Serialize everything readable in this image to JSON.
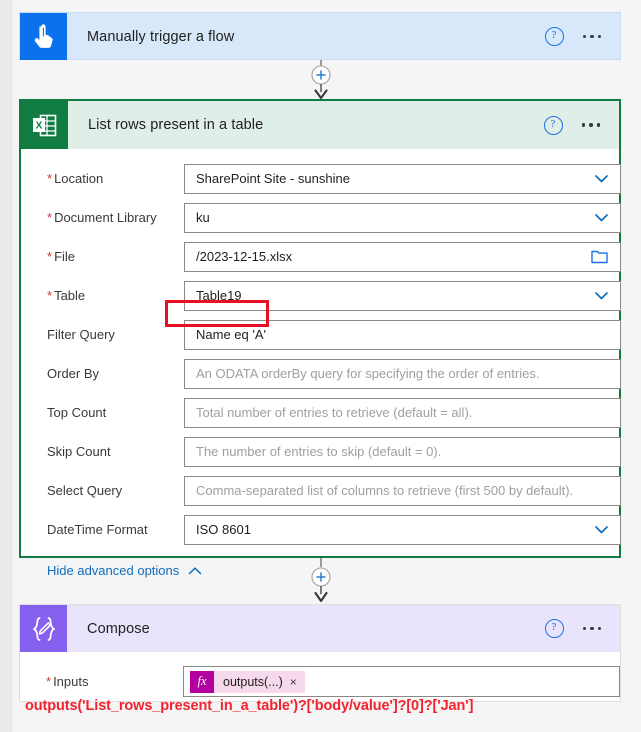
{
  "trigger_card": {
    "title": "Manually trigger a flow",
    "icon": "hand-tap-icon",
    "icon_bg": "#0b71ec",
    "card_bg": "#d7e8fb",
    "help_label": "?",
    "menu_label": "..."
  },
  "excel_card": {
    "title": "List rows present in a table",
    "icon": "excel-icon",
    "icon_bg": "#107c41",
    "header_bg": "#dfeee6",
    "border_color": "#107c41",
    "help_label": "?",
    "menu_label": "...",
    "fields": [
      {
        "label": "Location",
        "required": true,
        "value": "SharePoint Site - sunshine",
        "placeholder": "",
        "control": "dropdown"
      },
      {
        "label": "Document Library",
        "required": true,
        "value": "ku",
        "placeholder": "",
        "control": "dropdown"
      },
      {
        "label": "File",
        "required": true,
        "value": "/2023-12-15.xlsx",
        "placeholder": "",
        "control": "filepicker"
      },
      {
        "label": "Table",
        "required": true,
        "value": "Table19",
        "placeholder": "",
        "control": "dropdown"
      },
      {
        "label": "Filter Query",
        "required": false,
        "value": "Name eq 'A'",
        "placeholder": "",
        "control": "text"
      },
      {
        "label": "Order By",
        "required": false,
        "value": "",
        "placeholder": "An ODATA orderBy query for specifying the order of entries.",
        "control": "text"
      },
      {
        "label": "Top Count",
        "required": false,
        "value": "",
        "placeholder": "Total number of entries to retrieve (default = all).",
        "control": "text"
      },
      {
        "label": "Skip Count",
        "required": false,
        "value": "",
        "placeholder": "The number of entries to skip (default = 0).",
        "control": "text"
      },
      {
        "label": "Select Query",
        "required": false,
        "value": "",
        "placeholder": "Comma-separated list of columns to retrieve (first 500 by default).",
        "control": "text"
      },
      {
        "label": "DateTime Format",
        "required": true,
        "value": "ISO 8601",
        "placeholder": "",
        "control": "dropdown"
      }
    ],
    "advanced_toggle": "Hide advanced options",
    "advanced_chevron": "chevron-up-icon"
  },
  "compose_card": {
    "title": "Compose",
    "icon": "compose-braces-pencil-icon",
    "icon_bg": "#8661ef",
    "header_bg": "#e9e3fb",
    "help_label": "?",
    "menu_label": "...",
    "inputs_label": "Inputs",
    "inputs_required": true,
    "token": {
      "fx_label": "fx",
      "text": "outputs(...)",
      "remove_label": "×"
    }
  },
  "connectors": {
    "add_label": "+"
  },
  "annotation": {
    "text": "outputs('List_rows_present_in_a_table')?['body/value']?[0]?['Jan']",
    "color": "#f2232f"
  }
}
